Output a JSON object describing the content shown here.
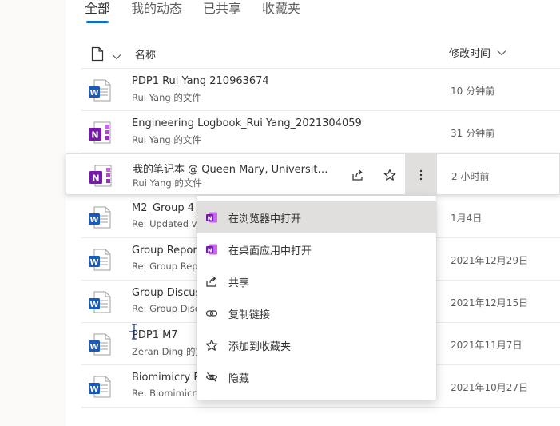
{
  "tabs": [
    {
      "label": "全部",
      "active": true
    },
    {
      "label": "我的动态",
      "active": false
    },
    {
      "label": "已共享",
      "active": false
    },
    {
      "label": "收藏夹",
      "active": false
    }
  ],
  "header": {
    "name_label": "名称",
    "modified_label": "修改时间"
  },
  "files": [
    {
      "type": "word",
      "title": "PDP1 Rui Yang 210963674",
      "sub": "Rui Yang 的文件",
      "time": "10 分钟前"
    },
    {
      "type": "onenote",
      "title": "Engineering Logbook_Rui Yang_2021304059",
      "sub": "Rui Yang 的文件",
      "time": "31 分钟前"
    },
    {
      "type": "onenote",
      "title": "我的笔记本 @ Queen Mary, University of London",
      "sub": "Rui Yang 的文件",
      "time": "2 小时前"
    },
    {
      "type": "word",
      "title": "M2_Group 4_",
      "sub": "Re: Updated ve",
      "time": "1月4日"
    },
    {
      "type": "word",
      "title": "Group Repor",
      "sub": "Re: Group Repo",
      "time": "2021年12月29日"
    },
    {
      "type": "word",
      "title": "Group Discus",
      "sub": "Re: Group Discu",
      "time": "2021年12月15日"
    },
    {
      "type": "word",
      "title": "PDP1 M7",
      "sub": "Zeran Ding 的文",
      "time": "2021年11月7日"
    },
    {
      "type": "word",
      "title": "Biomimicry P",
      "sub": "Re: Biomimicry",
      "time": "2021年10月27日"
    }
  ],
  "context_menu": [
    {
      "label": "在浏览器中打开",
      "icon": "onenote-icon",
      "selected": true
    },
    {
      "label": "在桌面应用中打开",
      "icon": "onenote-icon",
      "selected": false
    },
    {
      "label": "共享",
      "icon": "share-icon",
      "selected": false
    },
    {
      "label": "复制链接",
      "icon": "link-icon",
      "selected": false
    },
    {
      "label": "添加到收藏夹",
      "icon": "star-icon",
      "selected": false
    },
    {
      "label": "隐藏",
      "icon": "hide-icon",
      "selected": false
    }
  ],
  "colors": {
    "word": "#185abd",
    "onenote": "#7719aa",
    "accent": "#0f6cbd"
  }
}
